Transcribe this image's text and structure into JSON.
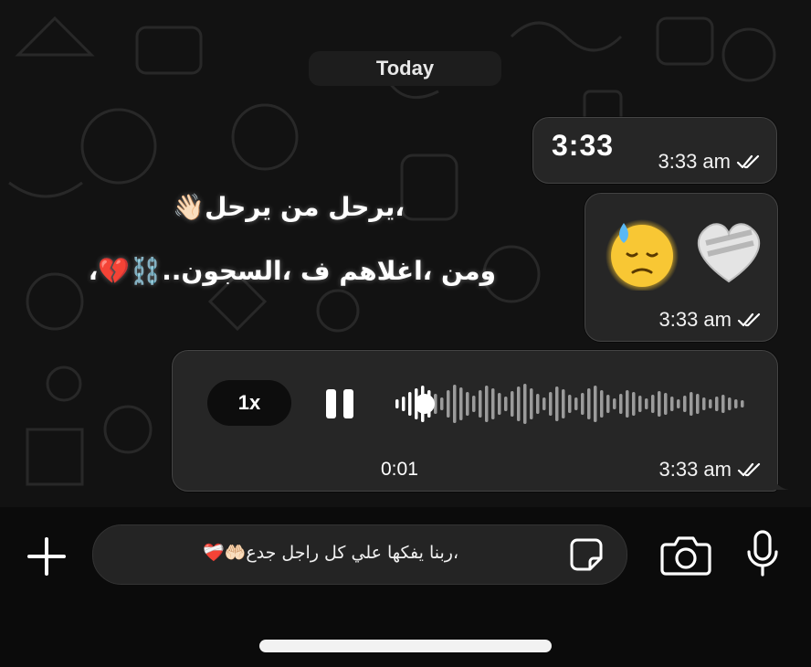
{
  "date_divider": "Today",
  "messages": [
    {
      "text": "3:33",
      "time": "3:33 am",
      "status": "read"
    },
    {
      "emojis": [
        "😓",
        "❤️‍🩹"
      ],
      "time": "3:33 am",
      "status": "read"
    },
    {
      "type": "voice",
      "speed": "1x",
      "elapsed": "0:01",
      "time": "3:33 am",
      "status": "read"
    }
  ],
  "overlay_text": {
    "line1": "،يرحل من يرحل👋🏻",
    "line2": "ومن ،اغلاهم ف ،السجون..⛓️💔،"
  },
  "composer": {
    "text": "،ربنا يفكها علي كل راجل جدع🤲🏻❤️‍🩹",
    "icons": [
      "plus-icon",
      "sticker-icon",
      "camera-icon",
      "microphone-icon"
    ]
  },
  "colors": {
    "bubble": "#262626",
    "background": "#121212",
    "accent": "#ffffff"
  }
}
